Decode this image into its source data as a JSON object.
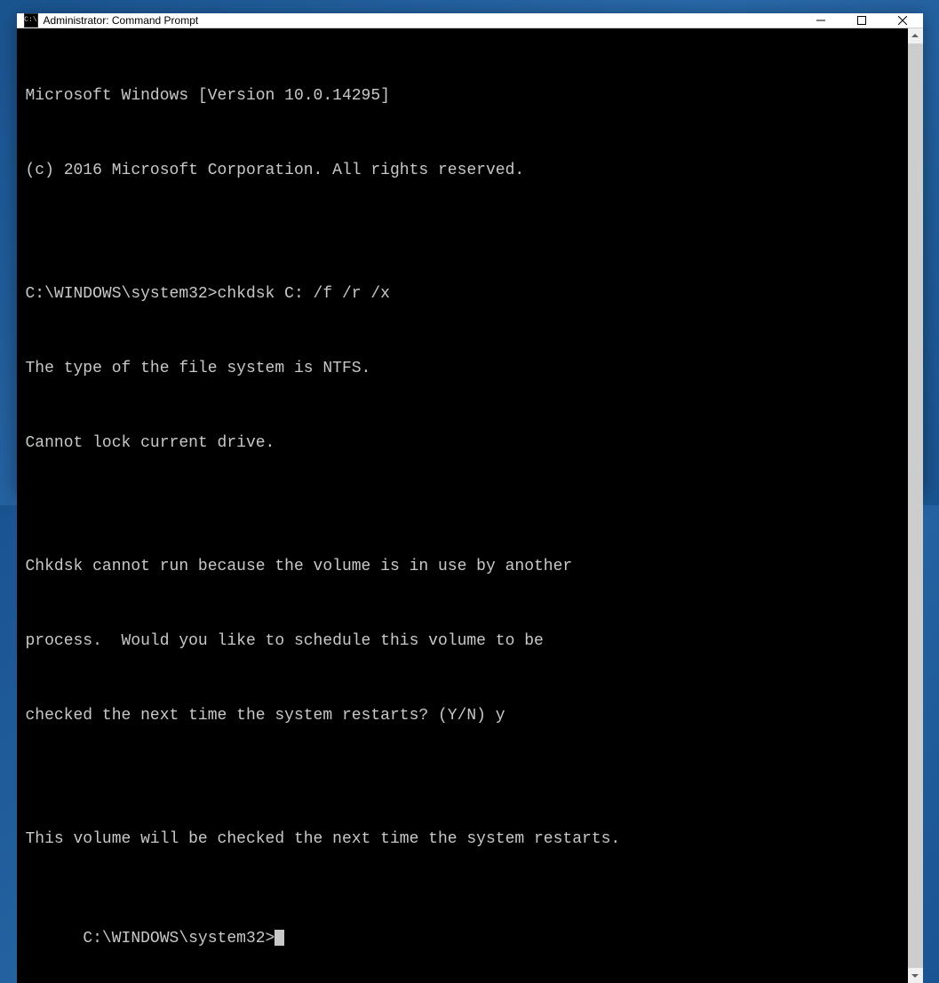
{
  "window": {
    "title": "Administrator: Command Prompt",
    "icon_text": "C:\\"
  },
  "terminal": {
    "lines": [
      "Microsoft Windows [Version 10.0.14295]",
      "(c) 2016 Microsoft Corporation. All rights reserved.",
      "",
      "C:\\WINDOWS\\system32>chkdsk C: /f /r /x",
      "The type of the file system is NTFS.",
      "Cannot lock current drive.",
      "",
      "Chkdsk cannot run because the volume is in use by another",
      "process.  Would you like to schedule this volume to be",
      "checked the next time the system restarts? (Y/N) y",
      "",
      "This volume will be checked the next time the system restarts.",
      ""
    ],
    "prompt": "C:\\WINDOWS\\system32>"
  }
}
